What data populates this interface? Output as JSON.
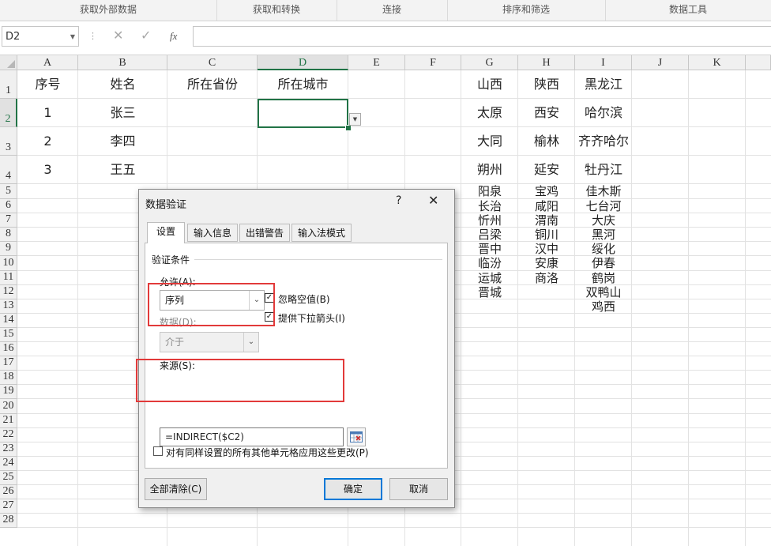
{
  "ribbon": {
    "groups": [
      {
        "label": "获取外部数据"
      },
      {
        "label": "获取和转换"
      },
      {
        "label": "连接"
      },
      {
        "label": "排序和筛选"
      },
      {
        "label": "数据工具"
      }
    ]
  },
  "formula_bar": {
    "name_box": "D2",
    "cancel_icon": "✕",
    "enter_icon": "✓",
    "fx_label": "fx",
    "content": ""
  },
  "columns": [
    "A",
    "B",
    "C",
    "D",
    "E",
    "F",
    "G",
    "H",
    "I",
    "J",
    "K"
  ],
  "rows": [
    "1",
    "2",
    "3",
    "4",
    "5",
    "6",
    "7",
    "8",
    "9",
    "10",
    "11",
    "12",
    "13",
    "14",
    "15",
    "16",
    "17",
    "18",
    "19",
    "20",
    "21",
    "22",
    "23",
    "24",
    "25",
    "26",
    "27",
    "28"
  ],
  "cells": {
    "A1": "序号",
    "B1": "姓名",
    "C1": "所在省份",
    "D1": "所在城市",
    "A2": "1",
    "B2": "张三",
    "A3": "2",
    "B3": "李四",
    "A4": "3",
    "B4": "王五",
    "G1": "山西",
    "H1": "陕西",
    "I1": "黑龙江",
    "G2": "太原",
    "H2": "西安",
    "I2": "哈尔滨",
    "G3": "大同",
    "H3": "榆林",
    "I3": "齐齐哈尔",
    "G4": "朔州",
    "H4": "延安",
    "I4": "牡丹江",
    "G5": "阳泉",
    "H5": "宝鸡",
    "I5": "佳木斯",
    "G6": "长治",
    "H6": "咸阳",
    "I6": "七台河",
    "G7": "忻州",
    "H7": "渭南",
    "I7": "大庆",
    "G8": "吕梁",
    "H8": "铜川",
    "I8": "黑河",
    "G9": "晋中",
    "H9": "汉中",
    "I9": "绥化",
    "G10": "临汾",
    "H10": "安康",
    "I10": "伊春",
    "G11": "运城",
    "H11": "商洛",
    "I11": "鹤岗",
    "G12": "晋城",
    "I12": "双鸭山",
    "I13": "鸡西"
  },
  "selection": {
    "cell": "D2",
    "column": "D",
    "row": "2"
  },
  "dialog": {
    "title": "数据验证",
    "help": "?",
    "close": "✕",
    "tabs": [
      {
        "label": "设置",
        "active": true
      },
      {
        "label": "输入信息",
        "active": false
      },
      {
        "label": "出错警告",
        "active": false
      },
      {
        "label": "输入法模式",
        "active": false
      }
    ],
    "criteria_label": "验证条件",
    "allow_label": "允许(A):",
    "allow_value": "序列",
    "data_label": "数据(D):",
    "data_value": "介于",
    "ignore_blank_label": "忽略空值(B)",
    "ignore_blank_checked": true,
    "dropdown_label": "提供下拉箭头(I)",
    "dropdown_checked": true,
    "source_label": "来源(S):",
    "source_value": "=INDIRECT($C2)",
    "apply_all_label": "对有同样设置的所有其他单元格应用这些更改(P)",
    "apply_all_checked": false,
    "clear_all_label": "全部清除(C)",
    "ok_label": "确定",
    "cancel_label": "取消"
  },
  "colors": {
    "selection_green": "#217346",
    "highlight_red": "#e23a3a",
    "ok_border": "#0078d7"
  }
}
